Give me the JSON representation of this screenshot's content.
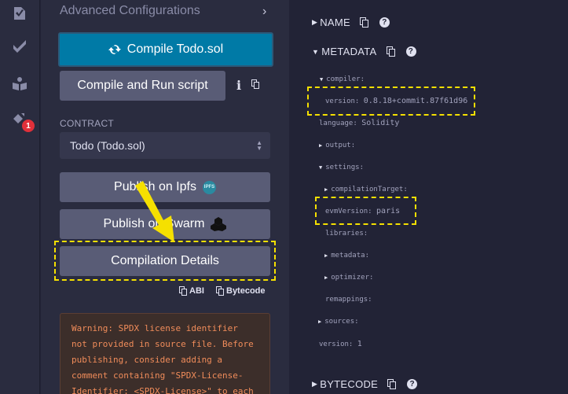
{
  "rail": {
    "icons": [
      "file-explorer-icon",
      "solidity-compiler-icon",
      "deploy-run-icon",
      "plugin-icon"
    ],
    "badge_count": "1"
  },
  "panel": {
    "advanced_label": "Advanced Configurations",
    "compile_button": "Compile Todo.sol",
    "run_script_button": "Compile and Run script",
    "contract_label": "CONTRACT",
    "contract_value": "Todo (Todo.sol)",
    "ipfs_button": "Publish on Ipfs",
    "ipfs_logo_text": "IPFS",
    "swarm_button": "Publish on Swarm",
    "details_button": "Compilation Details",
    "abi_label": "ABI",
    "bytecode_label": "Bytecode",
    "warning": "Warning: SPDX license identifier\nnot provided in source file. Before\npublishing, consider adding a\ncomment containing \"SPDX-License-\nIdentifier: <SPDX-License>\" to each"
  },
  "details": {
    "name_label": "NAME",
    "metadata_label": "METADATA",
    "bytecode_label": "BYTECODE",
    "compiler_key": "compiler:",
    "version_key": "version:",
    "version_value": "0.8.18+commit.87f61d96",
    "language_key": "language:",
    "language_value": "Solidity",
    "output_key": "output:",
    "settings_key": "settings:",
    "compilation_target_key": "compilationTarget:",
    "evm_version_key": "evmVersion:",
    "evm_version_value": "paris",
    "libraries_key": "libraries:",
    "metadata_key": "metadata:",
    "optimizer_key": "optimizer:",
    "remappings_key": "remappings:",
    "sources_key": "sources:",
    "meta_version_key": "version:",
    "meta_version_value": "1"
  },
  "colors": {
    "accent": "#007aa6",
    "highlight": "#f5e000",
    "warning": "#f08c5a"
  }
}
